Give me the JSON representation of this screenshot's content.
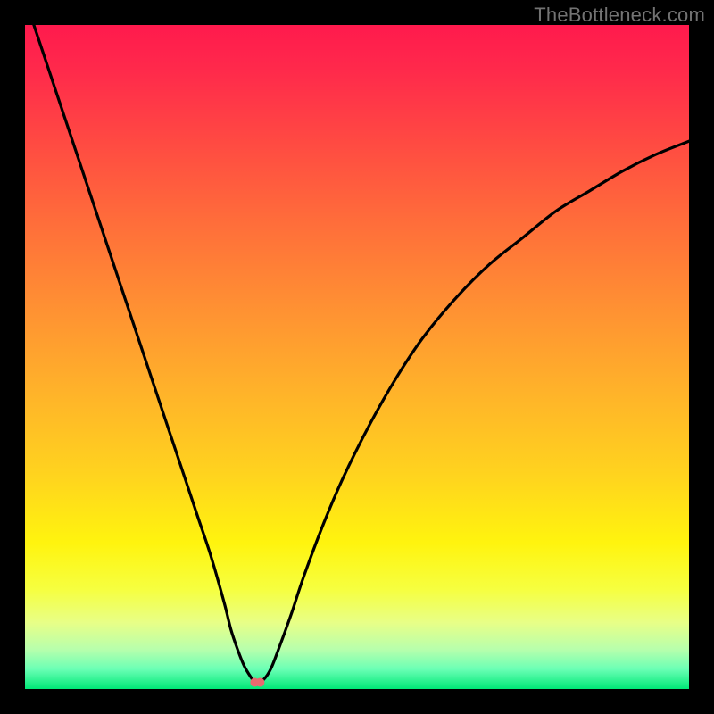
{
  "watermark": "TheBottleneck.com",
  "chart_data": {
    "type": "line",
    "title": "",
    "xlabel": "",
    "ylabel": "",
    "xlim": [
      0,
      100
    ],
    "ylim": [
      0,
      100
    ],
    "grid": false,
    "background_gradient_stops": [
      {
        "offset": 0.0,
        "color": "#ff1a4d"
      },
      {
        "offset": 0.07,
        "color": "#ff2a4b"
      },
      {
        "offset": 0.18,
        "color": "#ff4b42"
      },
      {
        "offset": 0.3,
        "color": "#ff6e3a"
      },
      {
        "offset": 0.42,
        "color": "#ff8f33"
      },
      {
        "offset": 0.55,
        "color": "#ffb22a"
      },
      {
        "offset": 0.68,
        "color": "#ffd41e"
      },
      {
        "offset": 0.78,
        "color": "#fff40e"
      },
      {
        "offset": 0.85,
        "color": "#f6ff40"
      },
      {
        "offset": 0.9,
        "color": "#e8ff87"
      },
      {
        "offset": 0.94,
        "color": "#b8ffac"
      },
      {
        "offset": 0.97,
        "color": "#6bffb5"
      },
      {
        "offset": 1.0,
        "color": "#00e877"
      }
    ],
    "series": [
      {
        "name": "curve",
        "x": [
          0,
          2,
          4,
          6,
          8,
          10,
          12,
          14,
          16,
          18,
          20,
          22,
          24,
          26,
          28,
          30,
          31,
          32,
          33,
          34,
          34.5,
          35,
          36,
          37,
          38,
          40,
          42,
          45,
          48,
          52,
          56,
          60,
          65,
          70,
          75,
          80,
          85,
          90,
          95,
          100
        ],
        "y": [
          104,
          98,
          92,
          86,
          80,
          74,
          68,
          62,
          56,
          50,
          44,
          38,
          32,
          26,
          20,
          13,
          9,
          6,
          3.5,
          1.8,
          1.2,
          1.0,
          1.5,
          3.0,
          5.5,
          11,
          17,
          25,
          32,
          40,
          47,
          53,
          59,
          64,
          68,
          72,
          75,
          78,
          80.5,
          82.5
        ]
      }
    ],
    "marker": {
      "x": 35,
      "y": 1.0,
      "color": "#e86a6f",
      "radius": 5
    }
  }
}
